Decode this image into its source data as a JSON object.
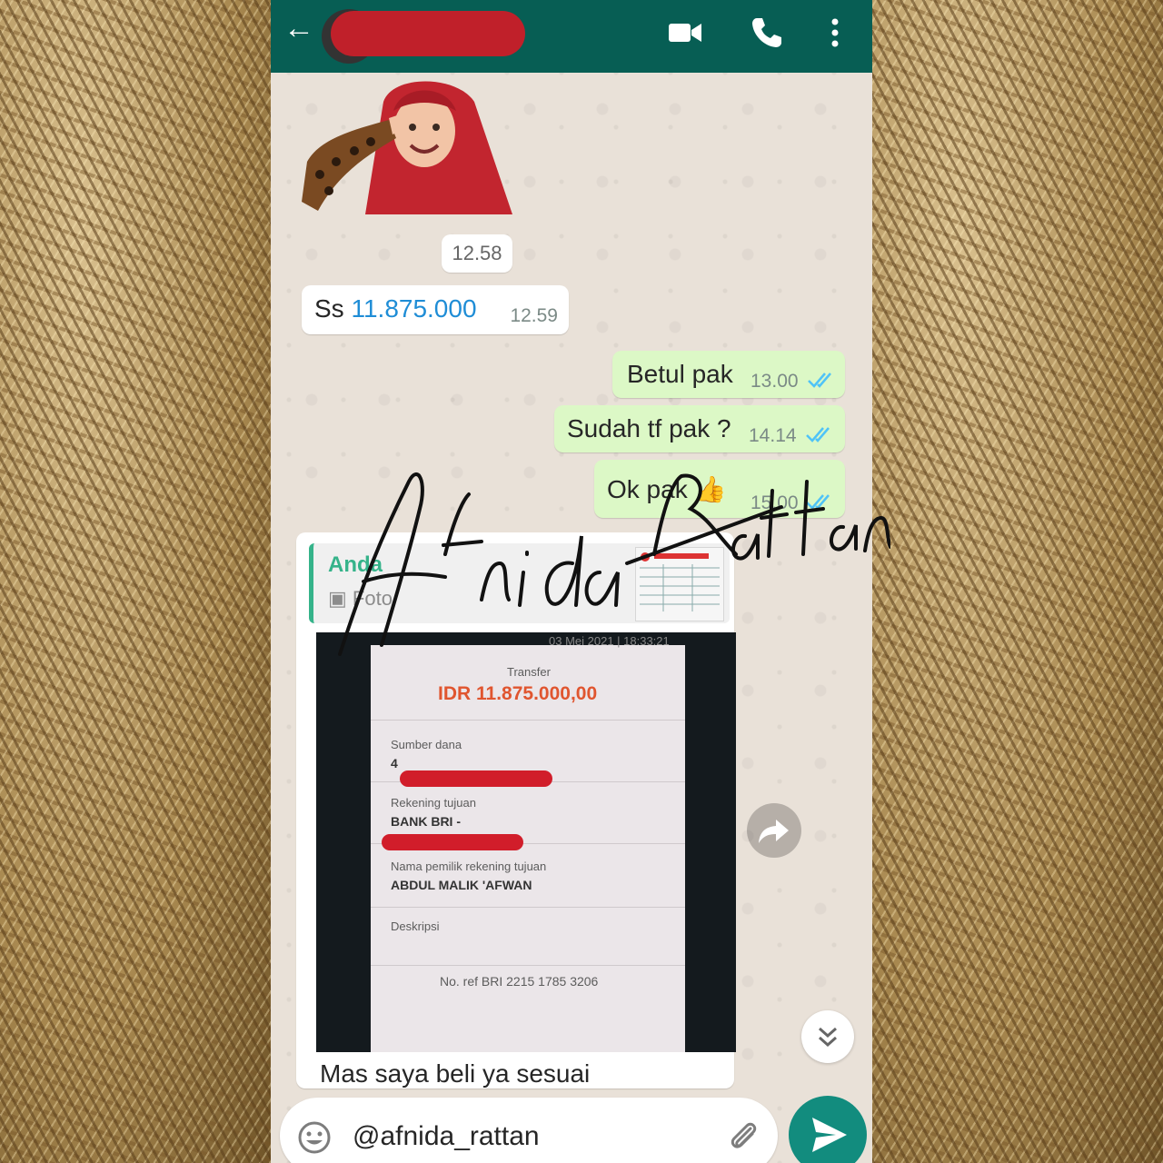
{
  "header": {
    "back_icon": "arrow-back-icon",
    "contact_name_redacted": true
  },
  "day_chip": "12.58",
  "messages": [
    {
      "dir": "in",
      "prefix": "Ss ",
      "amount": "11.875.000",
      "time": "12.59"
    },
    {
      "dir": "out",
      "text": "Betul pak",
      "time": "13.00"
    },
    {
      "dir": "out",
      "text": "Sudah tf pak ?",
      "time": "14.14"
    },
    {
      "dir": "out",
      "text": "Ok pak 👍",
      "time": "15.00"
    }
  ],
  "reply": {
    "quote_name": "Anda",
    "quote_type": "Foto",
    "photo": {
      "date": "03 Mei 2021 | 18:33:21",
      "title": "Transfer",
      "amount": "IDR 11.875.000,00",
      "source_label": "Sumber dana",
      "source_value": "4",
      "dest_label": "Rekening tujuan",
      "dest_value": "BANK BRI -",
      "owner_label": "Nama pemilik rekening tujuan",
      "owner_value": "ABDUL MALIK 'AFWAN",
      "desc_label": "Deskripsi",
      "ref": "No. ref BRI 2215 1785 3206"
    },
    "caption": "Mas saya beli ya sesuai"
  },
  "input": {
    "value": "@afnida_rattan"
  },
  "watermark": "Afnida_Rattan",
  "colors": {
    "header": "#075e54",
    "outgoing": "#dcf8c6",
    "incoming": "#ffffff",
    "send": "#128c7e",
    "tick": "#4fc3f7",
    "amount_link": "#1f8dd6",
    "transfer_amount": "#e0552f"
  }
}
